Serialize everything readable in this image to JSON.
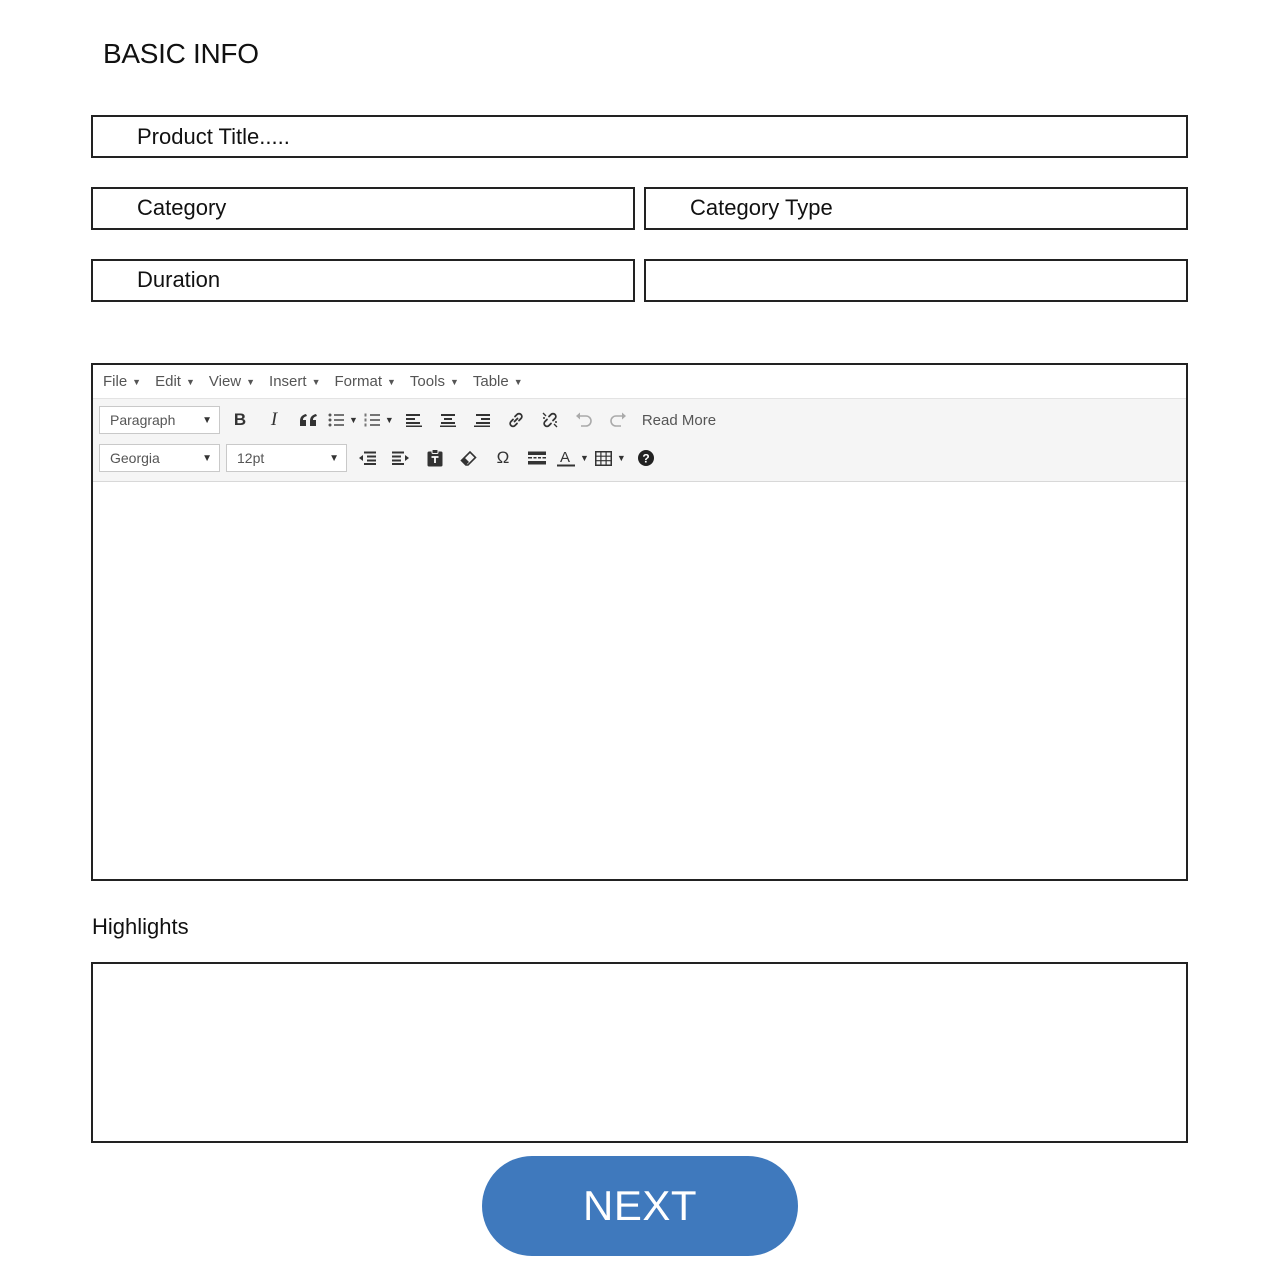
{
  "page": {
    "title": "BASIC INFO"
  },
  "fields": {
    "product_title_placeholder": "Product Title.....",
    "category_label": "Category",
    "category_type_label": "Category Type",
    "duration_label": "Duration"
  },
  "editor": {
    "menu": [
      "File",
      "Edit",
      "View",
      "Insert",
      "Format",
      "Tools",
      "Table"
    ],
    "block_format": "Paragraph",
    "font_family": "Georgia",
    "font_size": "12pt",
    "read_more": "Read More",
    "row1_icons": [
      "bold-icon",
      "italic-icon",
      "blockquote-icon",
      "bullet-list-icon",
      "numbered-list-icon",
      "align-left-icon",
      "align-center-icon",
      "align-right-icon",
      "link-icon",
      "unlink-icon",
      "undo-icon",
      "redo-icon"
    ],
    "row2_icons": [
      "outdent-icon",
      "indent-icon",
      "paste-text-icon",
      "eraser-icon",
      "omega-icon",
      "horizontal-rule-icon",
      "text-color-icon",
      "table-icon",
      "help-icon"
    ]
  },
  "highlights": {
    "label": "Highlights"
  },
  "actions": {
    "next_label": "NEXT"
  },
  "colors": {
    "accent": "#3f79bd",
    "border": "#222222",
    "toolbar_bg": "#f5f5f5"
  }
}
